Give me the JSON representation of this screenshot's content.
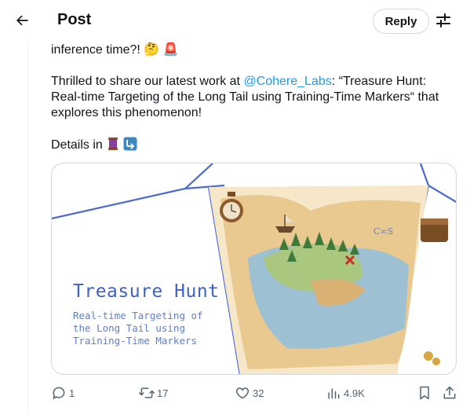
{
  "header": {
    "title": "Post",
    "reply_label": "Reply",
    "back_icon": "arrow-left-icon",
    "filter_icon": "tune-icon"
  },
  "post": {
    "line1": "inference time?! 🤔 🚨",
    "para_prefix": "Thrilled to share our latest work at ",
    "mention": "@Cohere_Labs",
    "para_suffix": ": “Treasure Hunt: Real-time Targeting of the Long Tail using Training-Time Markers“ that explores this phenomenon!",
    "details": "Details in",
    "details_emojis": [
      "thread-spool-icon",
      "arrow-down-right-icon"
    ]
  },
  "card": {
    "title": "Treasure Hunt",
    "subtitle": "Real-time Targeting of the Long Tail using Training-Time Markers"
  },
  "actions": {
    "replies": "1",
    "reposts": "17",
    "likes": "32",
    "views": "4.9K"
  },
  "colors": {
    "accent": "#1d9bf0",
    "card_blue": "#3f63c4",
    "muted": "#536471"
  }
}
